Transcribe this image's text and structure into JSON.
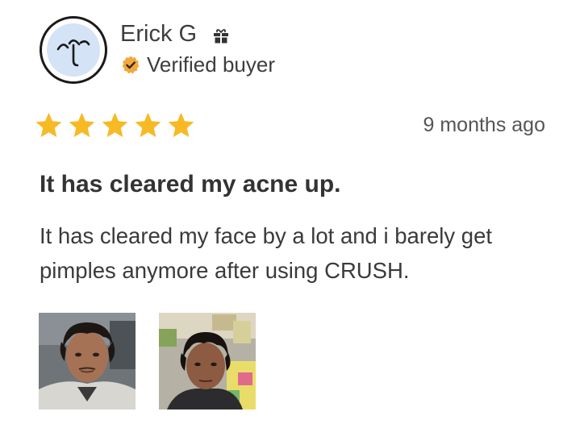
{
  "reviewer": {
    "name": "Erick G",
    "verified_label": "Verified buyer",
    "avatar_icon": "stylized-face-avatar",
    "badge_icon": "gift-icon",
    "verified_icon": "verified-badge-icon"
  },
  "review": {
    "rating": 5,
    "max_rating": 5,
    "date": "9 months ago",
    "title": "It has cleared my acne up.",
    "body": "It has cleared my face by a lot and i barely get pimples anymore after using CRUSH."
  },
  "photos": [
    {
      "icon": "customer-photo-1"
    },
    {
      "icon": "customer-photo-2"
    }
  ],
  "colors": {
    "star": "#f7b924",
    "verified_badge": "#f2a93b",
    "avatar_fill": "#d4e3f5",
    "text": "#333333"
  }
}
